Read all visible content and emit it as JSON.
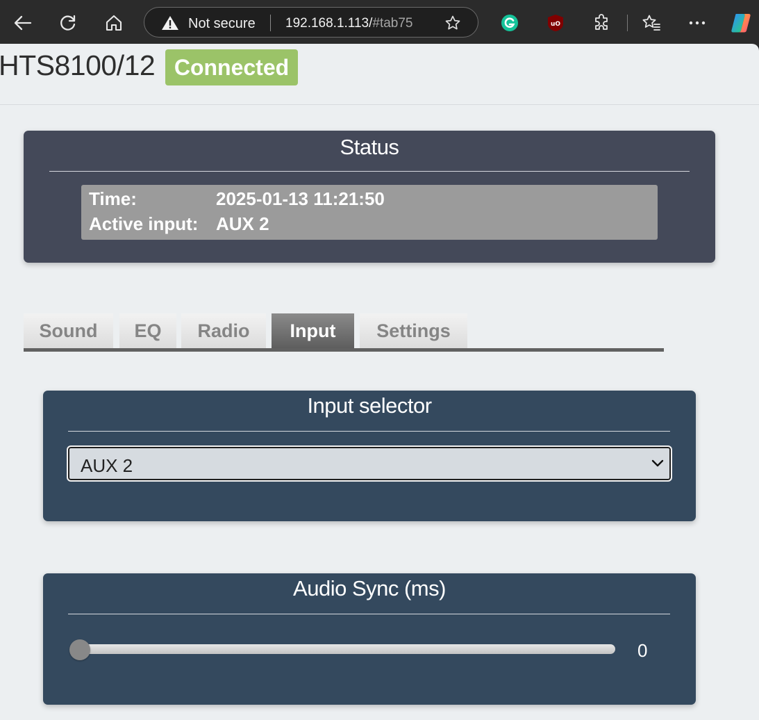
{
  "browser": {
    "security_label": "Not secure",
    "url_host": "192.168.1.113/",
    "url_fragment": "#tab75"
  },
  "header": {
    "device_name": "HTS8100/12",
    "connection_status": "Connected",
    "status_color": "#9bc368"
  },
  "status_panel": {
    "title": "Status",
    "time_label": "Time:",
    "time_value": "2025-01-13 11:21:50",
    "active_input_label": "Active input:",
    "active_input_value": "AUX 2"
  },
  "tabs": [
    {
      "label": "Sound",
      "active": false
    },
    {
      "label": "EQ",
      "active": false
    },
    {
      "label": "Radio",
      "active": false
    },
    {
      "label": "Input",
      "active": true
    },
    {
      "label": "Settings",
      "active": false
    }
  ],
  "input_selector": {
    "title": "Input selector",
    "selected": "AUX 2"
  },
  "audio_sync": {
    "title": "Audio Sync (ms)",
    "value": "0",
    "slider_fraction": 0
  },
  "colors": {
    "status_panel_bg": "#444959",
    "control_panel_bg": "#34495e",
    "status_box_bg": "#9b9b9b"
  },
  "icons": [
    "back-icon",
    "reload-icon",
    "home-icon",
    "warning-icon",
    "favorite-star-icon",
    "grammarly-icon",
    "ublock-origin-icon",
    "extensions-icon",
    "favorites-icon",
    "more-options-icon",
    "copilot-icon",
    "chevron-down-icon"
  ]
}
